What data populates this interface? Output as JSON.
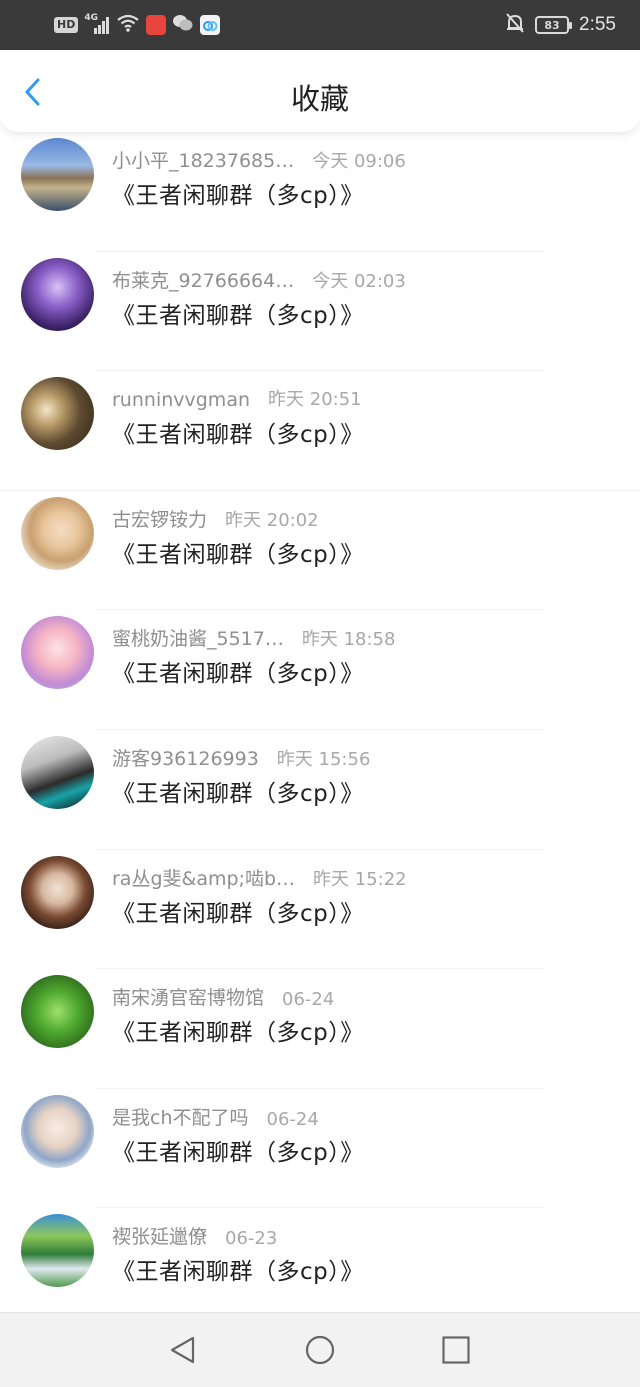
{
  "status_bar": {
    "hd_label": "HD",
    "signal_label": "4G",
    "battery": "83",
    "time": "2:55"
  },
  "header": {
    "title": "收藏",
    "accent": "#2e9bf0"
  },
  "items": [
    {
      "name": "小小平_18237685…",
      "time": "今天 09:06",
      "message": "《王者闲聊群（多cp）》"
    },
    {
      "name": "布莱克_92766664…",
      "time": "今天 02:03",
      "message": "《王者闲聊群（多cp）》"
    },
    {
      "name": "runninvvgman",
      "time": "昨天 20:51",
      "message": "《王者闲聊群（多cp）》"
    },
    {
      "name": "古宏锣铵力",
      "time": "昨天 20:02",
      "message": "《王者闲聊群（多cp）》"
    },
    {
      "name": "蜜桃奶油酱_5517…",
      "time": "昨天 18:58",
      "message": "《王者闲聊群（多cp）》"
    },
    {
      "name": "游客936126993",
      "time": "昨天 15:56",
      "message": "《王者闲聊群（多cp）》"
    },
    {
      "name": "ra丛g斐&amp;啮b…",
      "time": "昨天 15:22",
      "message": "《王者闲聊群（多cp）》"
    },
    {
      "name": "南宋湧官窑博物馆",
      "time": "06-24",
      "message": "《王者闲聊群（多cp）》"
    },
    {
      "name": "是我ch不配了吗",
      "time": "06-24",
      "message": "《王者闲聊群（多cp）》"
    },
    {
      "name": "禊张延邋僚",
      "time": "06-23",
      "message": "《王者闲聊群（多cp）》"
    }
  ]
}
